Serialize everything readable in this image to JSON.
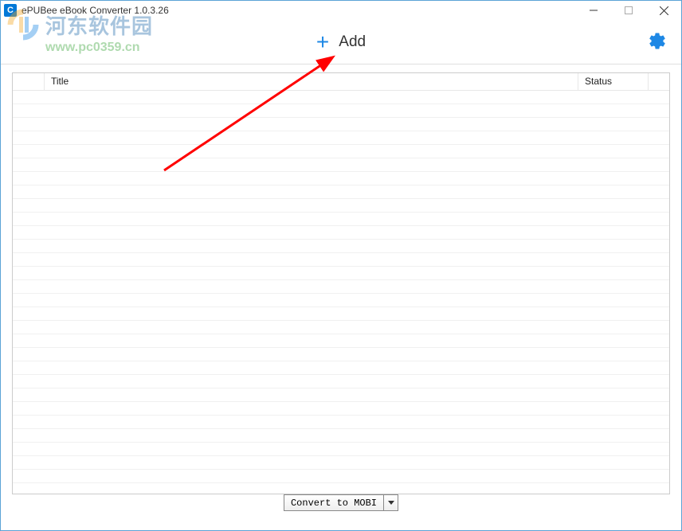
{
  "window": {
    "title": "ePUBee eBook Converter 1.0.3.26",
    "app_icon_letter": "C"
  },
  "toolbar": {
    "add_label": "Add"
  },
  "table": {
    "headers": {
      "title": "Title",
      "status": "Status"
    }
  },
  "footer": {
    "convert_label": "Convert to MOBI"
  },
  "watermark": {
    "text": "河东软件园",
    "url": "www.pc0359.cn"
  }
}
